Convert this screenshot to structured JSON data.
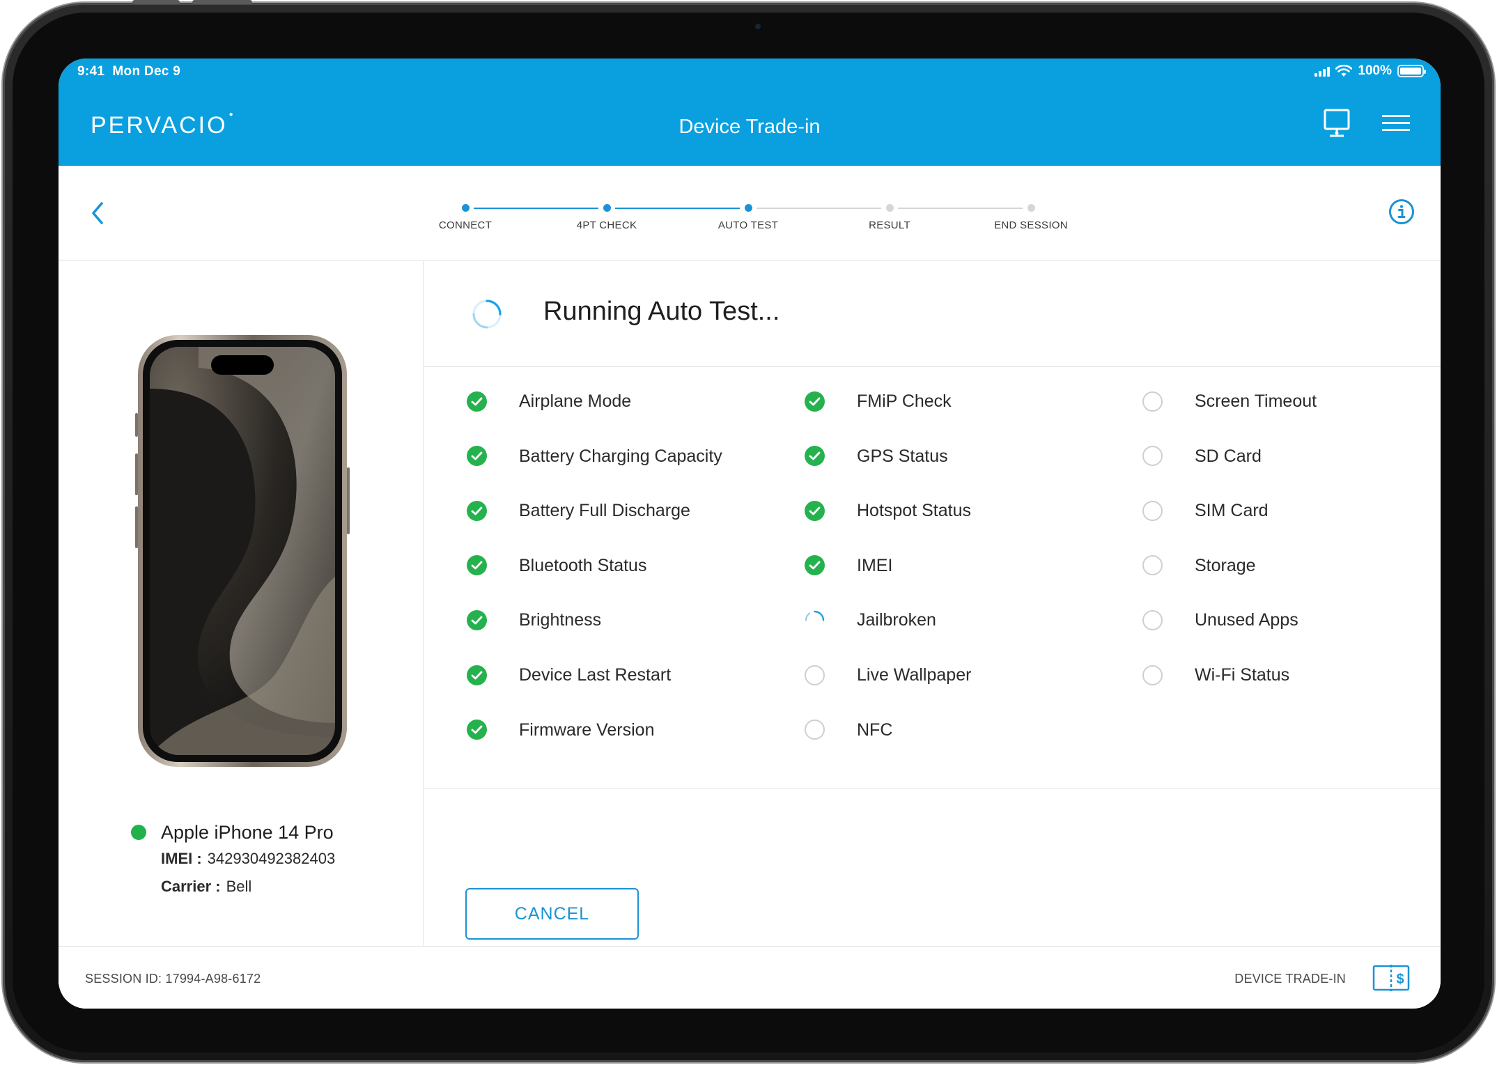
{
  "status_bar": {
    "time": "9:41",
    "date": "Mon Dec 9",
    "battery": "100%"
  },
  "header": {
    "logo": "PERVACIO",
    "title": "Device Trade-in"
  },
  "steps": [
    {
      "label": "CONNECT",
      "state": "done"
    },
    {
      "label": "4PT CHECK",
      "state": "done"
    },
    {
      "label": "AUTO TEST",
      "state": "current"
    },
    {
      "label": "RESULT",
      "state": "todo"
    },
    {
      "label": "END SESSION",
      "state": "todo"
    }
  ],
  "device": {
    "name": "Apple iPhone 14 Pro",
    "imei_label": "IMEI :",
    "imei": "342930492382403",
    "carrier_label": "Carrier :",
    "carrier": "Bell",
    "status_color": "#22b24c"
  },
  "run": {
    "title": "Running Auto Test..."
  },
  "tests": [
    [
      {
        "label": "Airplane Mode",
        "status": "passed"
      },
      {
        "label": "Battery Charging Capacity",
        "status": "passed"
      },
      {
        "label": "Battery Full Discharge",
        "status": "passed"
      },
      {
        "label": "Bluetooth Status",
        "status": "passed"
      },
      {
        "label": "Brightness",
        "status": "passed"
      },
      {
        "label": "Device Last Restart",
        "status": "passed"
      },
      {
        "label": "Firmware Version",
        "status": "passed"
      }
    ],
    [
      {
        "label": "FMiP Check",
        "status": "passed"
      },
      {
        "label": "GPS Status",
        "status": "passed"
      },
      {
        "label": "Hotspot Status",
        "status": "passed"
      },
      {
        "label": "IMEI",
        "status": "passed"
      },
      {
        "label": "Jailbroken",
        "status": "running"
      },
      {
        "label": "Live Wallpaper",
        "status": "pending"
      },
      {
        "label": "NFC",
        "status": "pending"
      }
    ],
    [
      {
        "label": "Screen Timeout",
        "status": "pending"
      },
      {
        "label": "SD Card",
        "status": "pending"
      },
      {
        "label": "SIM Card",
        "status": "pending"
      },
      {
        "label": "Storage",
        "status": "pending"
      },
      {
        "label": "Unused Apps",
        "status": "pending"
      },
      {
        "label": "Wi-Fi Status",
        "status": "pending"
      }
    ]
  ],
  "buttons": {
    "cancel": "CANCEL"
  },
  "footer": {
    "session": "SESSION ID: 17994-A98-6172",
    "right_label": "DEVICE TRADE-IN"
  },
  "colors": {
    "brand": "#0aa0e0",
    "accent": "#1a93d6",
    "passed": "#25b24e",
    "pending": "#cfcfcf"
  },
  "icons": {
    "back": "chevron-left-icon",
    "info": "info-icon",
    "monitor": "monitor-icon",
    "menu": "hamburger-menu-icon",
    "passed": "check-circle-icon",
    "running": "spinner-icon",
    "pending": "empty-circle-icon",
    "trade_in": "trade-in-icon"
  }
}
